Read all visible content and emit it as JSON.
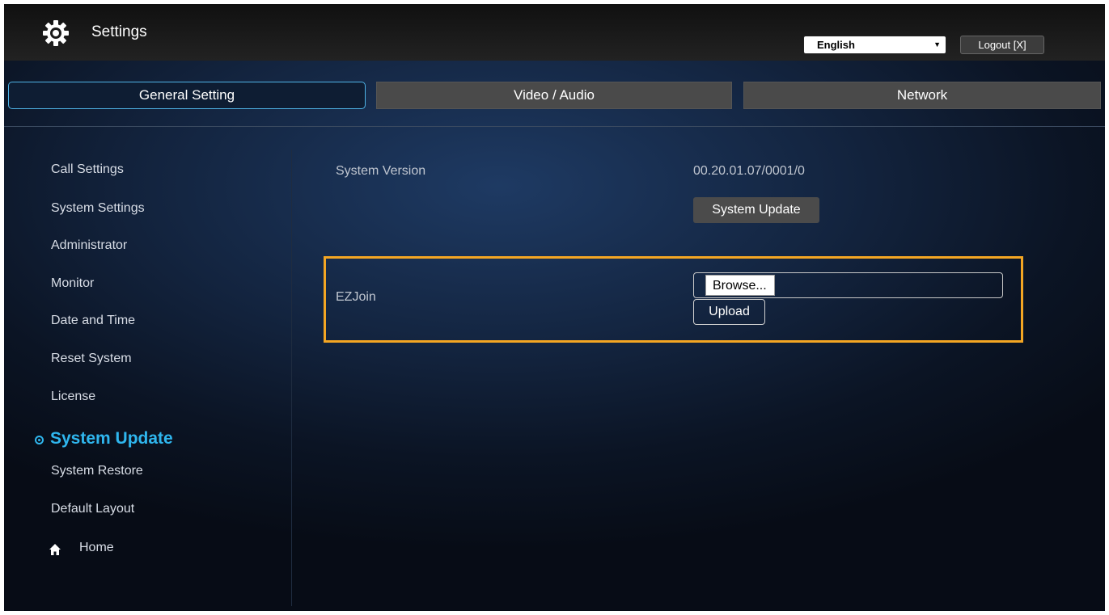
{
  "header": {
    "title": "Settings",
    "language": "English",
    "logout": "Logout [X]"
  },
  "tabs": [
    {
      "label": "General Setting",
      "active": true
    },
    {
      "label": "Video / Audio",
      "active": false
    },
    {
      "label": "Network",
      "active": false
    }
  ],
  "sidebar": {
    "items": [
      {
        "label": "Call Settings"
      },
      {
        "label": "System Settings"
      },
      {
        "label": "Administrator"
      },
      {
        "label": "Monitor"
      },
      {
        "label": "Date and Time"
      },
      {
        "label": "Reset System"
      },
      {
        "label": "License"
      },
      {
        "label": "System Update",
        "active": true
      },
      {
        "label": "System Restore"
      },
      {
        "label": "Default Layout"
      }
    ],
    "home": "Home"
  },
  "main": {
    "system_version_label": "System Version",
    "system_version_value": "00.20.01.07/0001/0",
    "system_update_button": "System Update",
    "ezjoin_label": "EZJoin",
    "browse_button": "Browse...",
    "upload_button": "Upload"
  },
  "colors": {
    "accent": "#2fb6ee",
    "highlight": "#f4a623"
  }
}
